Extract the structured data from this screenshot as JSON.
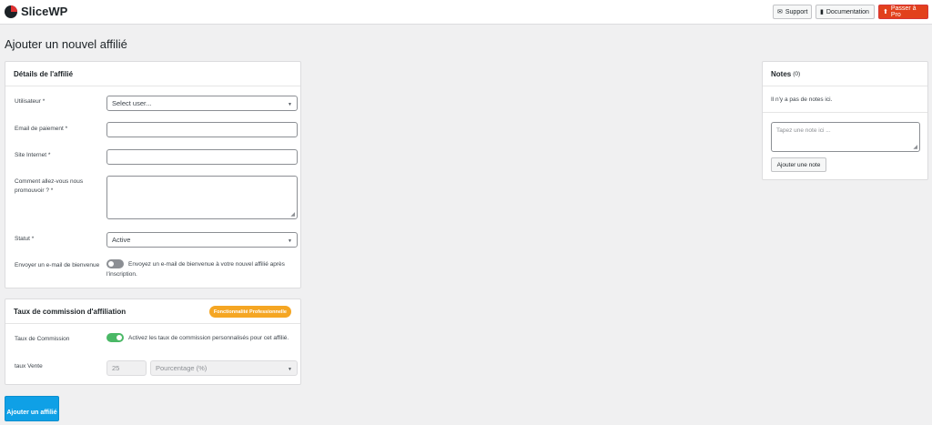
{
  "brand": {
    "name": "SliceWP"
  },
  "topbar": {
    "support_label": "Support",
    "docs_label": "Documentation",
    "pro_label": "Passer à Pro"
  },
  "page": {
    "title": "Ajouter un nouvel affilié"
  },
  "details": {
    "title": "Détails de l'affilié",
    "user_label": "Utilisateur *",
    "user_value": "Select user...",
    "payment_email_label": "Email de paiement *",
    "payment_email_value": "",
    "website_label": "Site Internet *",
    "website_value": "",
    "promote_label": "Comment allez-vous nous promouvoir ? *",
    "promote_value": "",
    "status_label": "Statut *",
    "status_value": "Active",
    "welcome_label": "Envoyer un e-mail de bienvenue",
    "welcome_text": "Envoyez un e-mail de bienvenue à votre nouvel affilié après l'inscription.",
    "welcome_enabled": false
  },
  "commission": {
    "title": "Taux de commission d'affiliation",
    "badge": "Fonctionnalité Professionnelle",
    "rate_toggle_label": "Taux de Commission",
    "rate_toggle_text": "Activez les taux de commission personnalisés pour cet affilié.",
    "rate_toggle_enabled": true,
    "sale_rate_label": "taux Vente",
    "sale_rate_value": "25",
    "sale_rate_type": "Pourcentage (%)"
  },
  "notes": {
    "title": "Notes",
    "count": "(0)",
    "empty_text": "Il n'y a pas de notes ici.",
    "placeholder": "Tapez une note ici ...",
    "add_label": "Ajouter une note"
  },
  "submit_label": "Ajouter un affilié",
  "colors": {
    "primary": "#0fa0e6",
    "pro": "#e2401c",
    "badge": "#f5a623",
    "toggle_on": "#4ab866"
  }
}
